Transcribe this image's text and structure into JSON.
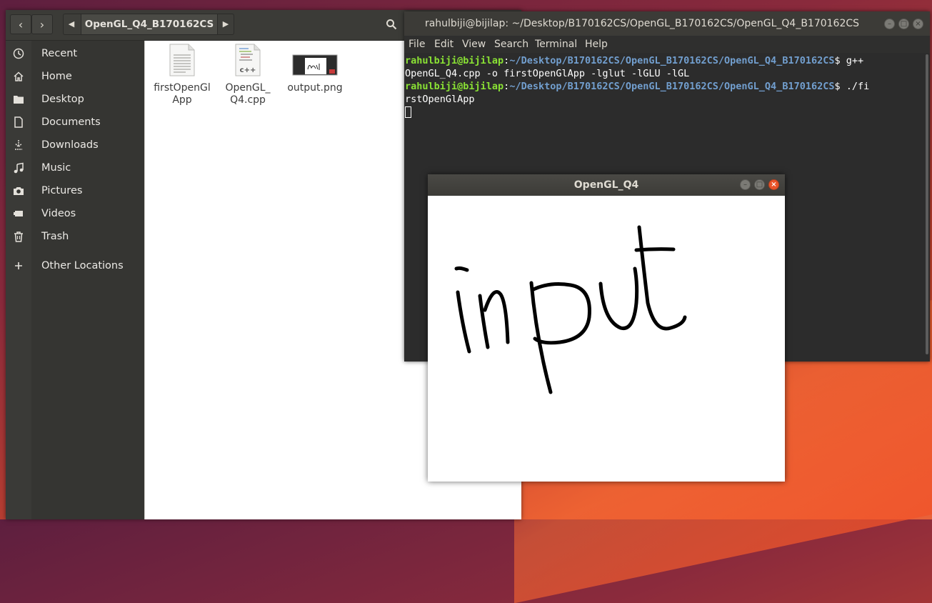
{
  "files": {
    "path_crumb": "OpenGL_Q4_B170162CS",
    "sidebar": [
      {
        "label": "Recent",
        "icon": "clock-icon"
      },
      {
        "label": "Home",
        "icon": "home-icon"
      },
      {
        "label": "Desktop",
        "icon": "folder-icon"
      },
      {
        "label": "Documents",
        "icon": "document-icon"
      },
      {
        "label": "Downloads",
        "icon": "download-icon"
      },
      {
        "label": "Music",
        "icon": "music-icon"
      },
      {
        "label": "Pictures",
        "icon": "camera-icon"
      },
      {
        "label": "Videos",
        "icon": "video-icon"
      },
      {
        "label": "Trash",
        "icon": "trash-icon"
      },
      {
        "label": "Other Locations",
        "icon": "plus-icon"
      }
    ],
    "items": [
      {
        "name_line1": "firstOpenGl",
        "name_line2": "App",
        "icon": "executable-file-icon"
      },
      {
        "name_line1": "OpenGL_",
        "name_line2": "Q4.cpp",
        "icon": "cpp-file-icon",
        "badge": "c++"
      },
      {
        "name_line1": "output.png",
        "name_line2": "",
        "icon": "image-file-icon"
      }
    ]
  },
  "terminal": {
    "title": "rahulbiji@bijilap: ~/Desktop/B170162CS/OpenGL_B170162CS/OpenGL_Q4_B170162CS",
    "menu": [
      "File",
      "Edit",
      "View",
      "Search",
      "Terminal",
      "Help"
    ],
    "lines": [
      {
        "user": "rahulbiji@bijilap",
        "sep": ":",
        "path": "~/Desktop/B170162CS/OpenGL_B170162CS/OpenGL_Q4_B170162CS",
        "cmd": "$ g++"
      },
      {
        "text": "OpenGL_Q4.cpp -o firstOpenGlApp -lglut -lGLU -lGL"
      },
      {
        "user": "rahulbiji@bijilap",
        "sep": ":",
        "path": "~/Desktop/B170162CS/OpenGL_B170162CS/OpenGL_Q4_B170162CS",
        "cmd": "$ ./fi"
      },
      {
        "text": "rstOpenGlApp"
      }
    ]
  },
  "opengl": {
    "title": "OpenGL_Q4",
    "drawing": "input"
  }
}
